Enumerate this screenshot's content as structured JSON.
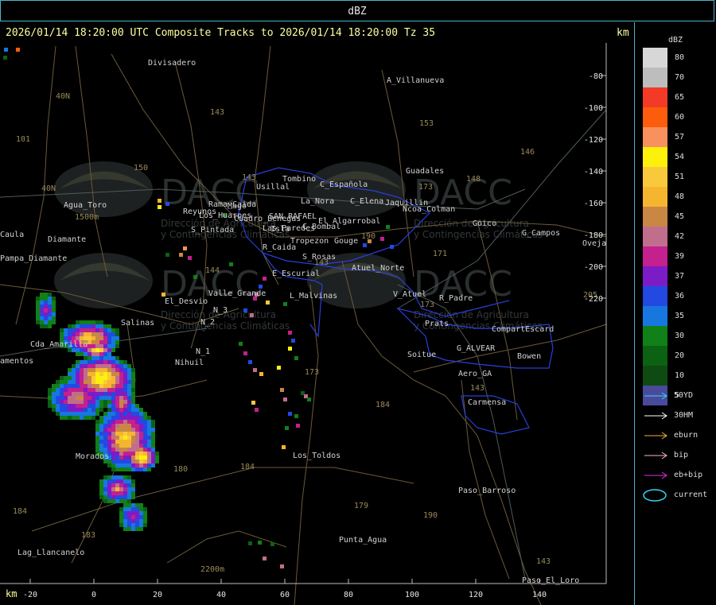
{
  "window": {
    "title": "dBZ"
  },
  "header": {
    "text": "2026/01/14 18:20:00 UTC Composite Tracks to 2026/01/14 18:20:00 Tz 35",
    "km_top": "km",
    "km_bottom": "km"
  },
  "watermark": {
    "logo_text": "DACC",
    "line1": "Dirección de Agricultura",
    "line2": "y Contingencias Climáticas"
  },
  "legend": {
    "title": "dBZ",
    "items": [
      {
        "label": "80",
        "color": "#d7d7d7"
      },
      {
        "label": "70",
        "color": "#bdbdbd"
      },
      {
        "label": "65",
        "color": "#f33a26"
      },
      {
        "label": "60",
        "color": "#fb5d0c"
      },
      {
        "label": "57",
        "color": "#f9915e"
      },
      {
        "label": "54",
        "color": "#fdf10b"
      },
      {
        "label": "51",
        "color": "#f9c93b"
      },
      {
        "label": "48",
        "color": "#f6b52f"
      },
      {
        "label": "45",
        "color": "#c98743"
      },
      {
        "label": "42",
        "color": "#c06e8c"
      },
      {
        "label": "39",
        "color": "#c4208e"
      },
      {
        "label": "37",
        "color": "#7c1cc6"
      },
      {
        "label": "36",
        "color": "#2249e2"
      },
      {
        "label": "35",
        "color": "#1777df"
      },
      {
        "label": "30",
        "color": "#108018"
      },
      {
        "label": "20",
        "color": "#0a6212"
      },
      {
        "label": "10",
        "color": "#0f4a13"
      },
      {
        "label": "5",
        "color": "#4a4a9c"
      }
    ]
  },
  "tracks_legend": [
    {
      "label": "50YD",
      "color": "#35d4f0",
      "icon": "arrow-icon"
    },
    {
      "label": "30HM",
      "color": "#ffffff",
      "icon": "arrow-icon"
    },
    {
      "label": "eburn",
      "color": "#f3b23a",
      "icon": "arrow-icon"
    },
    {
      "label": "bip",
      "color": "#f7b6c8",
      "icon": "arrow-icon"
    },
    {
      "label": "eb+bip",
      "color": "#e12ce9",
      "icon": "arrow-icon"
    },
    {
      "label": "current",
      "color": "#35d4f0",
      "icon": "ellipse-icon"
    }
  ],
  "axes": {
    "x_ticks": [
      "-20",
      "0",
      "20",
      "40",
      "60",
      "80",
      "100",
      "120",
      "140"
    ],
    "y_ticks": [
      "-80",
      "-100",
      "-120",
      "-140",
      "-160",
      "-180",
      "-200",
      "-220"
    ]
  },
  "places": [
    "Divisadero",
    "A_Villanueva",
    "Guadales",
    "Tombino",
    "Usillal",
    "C_Española",
    "La_Nora",
    "C_Elena",
    "Jaquillin",
    "Rama_Caida",
    "Cuadro_Benegas",
    "SAN_RAFAEL",
    "El_Algarrobal",
    "Las_Paredes",
    "C_Bombal",
    "Reyunos",
    "Mago",
    "S_Pintada",
    "Isla",
    "Tropezon",
    "Gouge",
    "Goico",
    "G_Campos",
    "Oveja",
    "Agua_Toro",
    "Pampa_Diamante",
    "Caula",
    "Diamante",
    "R_Caida",
    "S_Rosas",
    "E_Escurial",
    "Atuel_Norte",
    "Valle_Grande",
    "L_Malvinas",
    "V_Atuel",
    "R_Padre",
    "El_Desvio",
    "N_3",
    "N_2",
    "N_1",
    "Salinas",
    "Cda_Amarilla",
    "amentos",
    "Nihuil",
    "Prats",
    "CompartEscard",
    "G_ALVEAR",
    "Soitue",
    "Bowen",
    "Aero_GA",
    "Carmensa",
    "Morados",
    "Los_Toldos",
    "Paso_Barroso",
    "Punta_Agua",
    "Lag_Llancanelo",
    "Paso_El_Loro",
    "Ncoa_Colman",
    "Los_Huarpes"
  ],
  "routes": [
    "101",
    "40N",
    "143",
    "150",
    "153",
    "146",
    "148",
    "40N",
    "1500m",
    "143",
    "144",
    "173",
    "171",
    "143",
    "190",
    "180",
    "184",
    "183",
    "184",
    "179",
    "173",
    "143",
    "190",
    "184",
    "143",
    "205",
    "2200m",
    "173"
  ]
}
